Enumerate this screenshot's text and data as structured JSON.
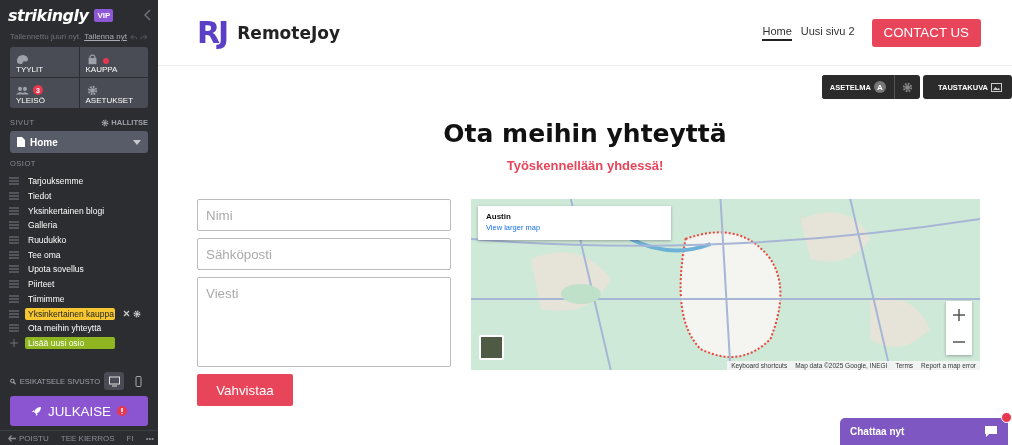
{
  "sidebar": {
    "brand": "strikingly",
    "brand_badge": "VIP",
    "save_status": "Tallennettu juuri nyt.",
    "save_link": "Tallenna nyt",
    "tiles": [
      {
        "kind": "styles",
        "label": "TYYLIT"
      },
      {
        "kind": "store",
        "label": "KAUPPA",
        "alert": true
      },
      {
        "kind": "audience",
        "label": "YLEISÖ",
        "badge": "3"
      },
      {
        "kind": "settings",
        "label": "ASETUKSET"
      }
    ],
    "pages_label": "SIVUT",
    "manage": "HALLITSE",
    "page_select": "Home",
    "sections_label": "OSIOT",
    "sections": [
      {
        "label": "Tarjouksemme",
        "selected": false
      },
      {
        "label": "Tiedot",
        "selected": false
      },
      {
        "label": "Yksinkertainen blogi",
        "selected": false
      },
      {
        "label": "Galleria",
        "selected": false
      },
      {
        "label": "Ruudukko",
        "selected": false
      },
      {
        "label": "Tee oma",
        "selected": false
      },
      {
        "label": "Upota sovellus",
        "selected": false
      },
      {
        "label": "Piirteet",
        "selected": false
      },
      {
        "label": "Tiimimme",
        "selected": false
      },
      {
        "label": "Yksinkertainen kauppa",
        "selected": true
      },
      {
        "label": "Ota meihin yhteyttä",
        "selected": false
      }
    ],
    "add_section": "Lisää uusi osio",
    "preview": "ESIKATSELE SIVUSTO",
    "devices": [
      {
        "kind": "desktop",
        "selected": true
      },
      {
        "kind": "mobile",
        "selected": false
      }
    ],
    "publish": "JULKAISE",
    "footer": [
      "POISTU",
      "TEE KIERROS",
      "FI",
      "•••"
    ]
  },
  "site": {
    "logo_mark": "RJ",
    "name": "RemoteJoy",
    "nav": [
      {
        "label": "Home",
        "selected": true
      },
      {
        "label": "Uusi sivu 2",
        "selected": false
      }
    ],
    "cta": "CONTACT US"
  },
  "editor_toolbar": {
    "layout": "ASETELMA",
    "layout_badge": "A",
    "background": "TAUSTAKUVA"
  },
  "content": {
    "title": "Ota meihin yhteyttä",
    "subtitle": "Työskennellään yhdessä!",
    "form": {
      "fields": [
        {
          "kind": "input",
          "placeholder": "Nimi"
        },
        {
          "kind": "input",
          "placeholder": "Sähköposti"
        },
        {
          "kind": "textarea",
          "placeholder": "Viesti"
        }
      ],
      "submit": "Vahvistaa"
    },
    "map": {
      "place": "Austin",
      "link": "View larger map",
      "attribution": [
        "Keyboard shortcuts",
        "Map data ©2025 Google, INEGI",
        "Terms",
        "Report a map error"
      ]
    }
  },
  "chat": {
    "label": "Chattaa nyt",
    "unread": true
  }
}
